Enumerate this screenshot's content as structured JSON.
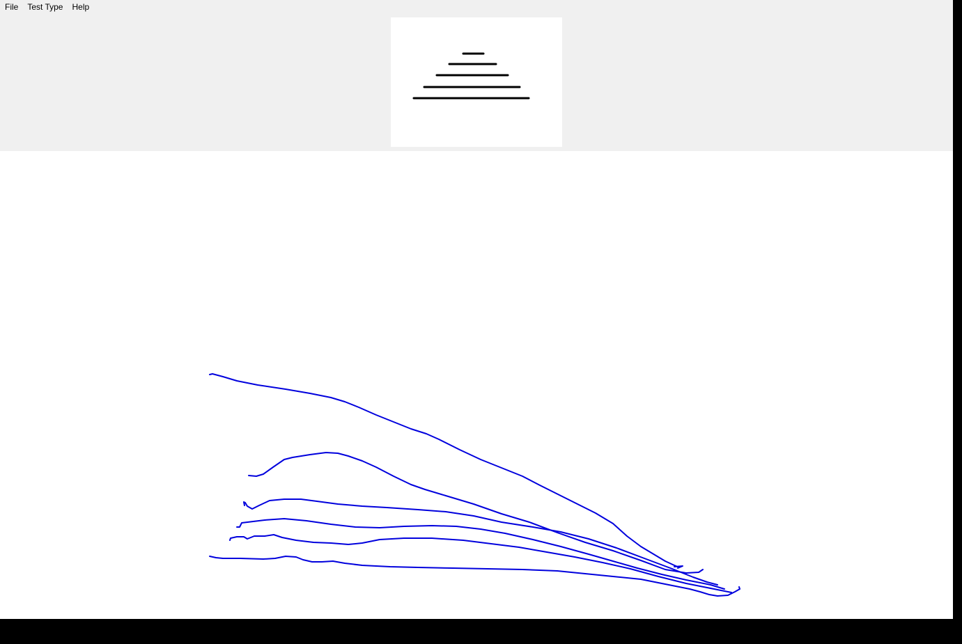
{
  "menu": {
    "file": "File",
    "test_type": "Test Type",
    "help": "Help"
  },
  "colors": {
    "menu_background": "#f0f0f0",
    "canvas_background": "#ffffff",
    "reference_line_color": "#000000",
    "trace_color": "#0000dd"
  },
  "reference_pattern": {
    "shape": "stacked horizontal lines (pyramid)",
    "line_count": 5
  },
  "traces": {
    "count": 6,
    "color_name": "blue"
  }
}
